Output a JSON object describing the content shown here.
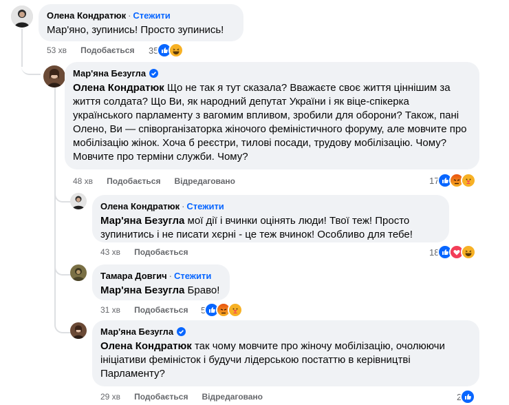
{
  "follow_label": "Стежити",
  "like_label": "Подобається",
  "edited_label": "Відредаговано",
  "comments": [
    {
      "author": "Олена Кондратюк",
      "show_follow": true,
      "text_mention": "",
      "text": "Мар'яно, зупинись! Просто зупинись!",
      "time": "53 хв",
      "reaction_count": "35",
      "reactions": [
        "like-icon",
        "haha-icon"
      ]
    },
    {
      "author": "Мар'яна Безугла",
      "verified": true,
      "text_mention": "Олена Кондратюк",
      "text": "Що не так я тут сказала? Вважаєте своє життя ціннішим за життя солдата? Що Ви, як народний депутат України і як віце-спікерка українського парламенту з вагомим впливом, зробили для оборони? Також, пані Олено, Ви — співорганізаторка жіночого феміністичного форуму, але мовчите про мобілізацію жінок. Хоча б реєстри, тилові посади, трудову мобілізацію. Чому? Мовчите про терміни служби. Чому?",
      "time": "48 хв",
      "reaction_count": "17",
      "reactions": [
        "like-icon",
        "angry-icon",
        "care-icon"
      ],
      "edited": true
    },
    {
      "author": "Олена Кондратюк",
      "show_follow": true,
      "text_mention": "Мар'яна Безугла",
      "text": "мої дії і вчинки оцінять люди! Твої теж! Просто зупинитись і не писати хєрні - це теж вчинок! Особливо для тебе!",
      "time": "43 хв",
      "reaction_count": "18",
      "reactions": [
        "like-icon",
        "love-icon",
        "haha-icon"
      ]
    },
    {
      "author": "Тамара Довгич",
      "show_follow": true,
      "text_mention": "Мар'яна Безугла",
      "text": "Браво!",
      "time": "31 хв",
      "reaction_count": "5",
      "reactions": [
        "like-icon",
        "angry-icon",
        "care-icon"
      ]
    },
    {
      "author": "Мар'яна Безугла",
      "verified": true,
      "text_mention": "Олена Кондратюк",
      "text": "так чому мовчите про жіночу мобілізацію, очолюючи ініціативи феміністок і будучи лідерською постаттю в керівництві Парламенту?",
      "time": "29 хв",
      "reaction_count": "2",
      "reactions": [
        "like-icon"
      ],
      "edited": true
    }
  ],
  "colors": {
    "bubble": "#f0f2f5",
    "link": "#0866ff",
    "meta": "#65676b",
    "like": "#0866ff",
    "love": "#f33e58",
    "angry": "#e9710f",
    "haha": "#f7b125"
  }
}
